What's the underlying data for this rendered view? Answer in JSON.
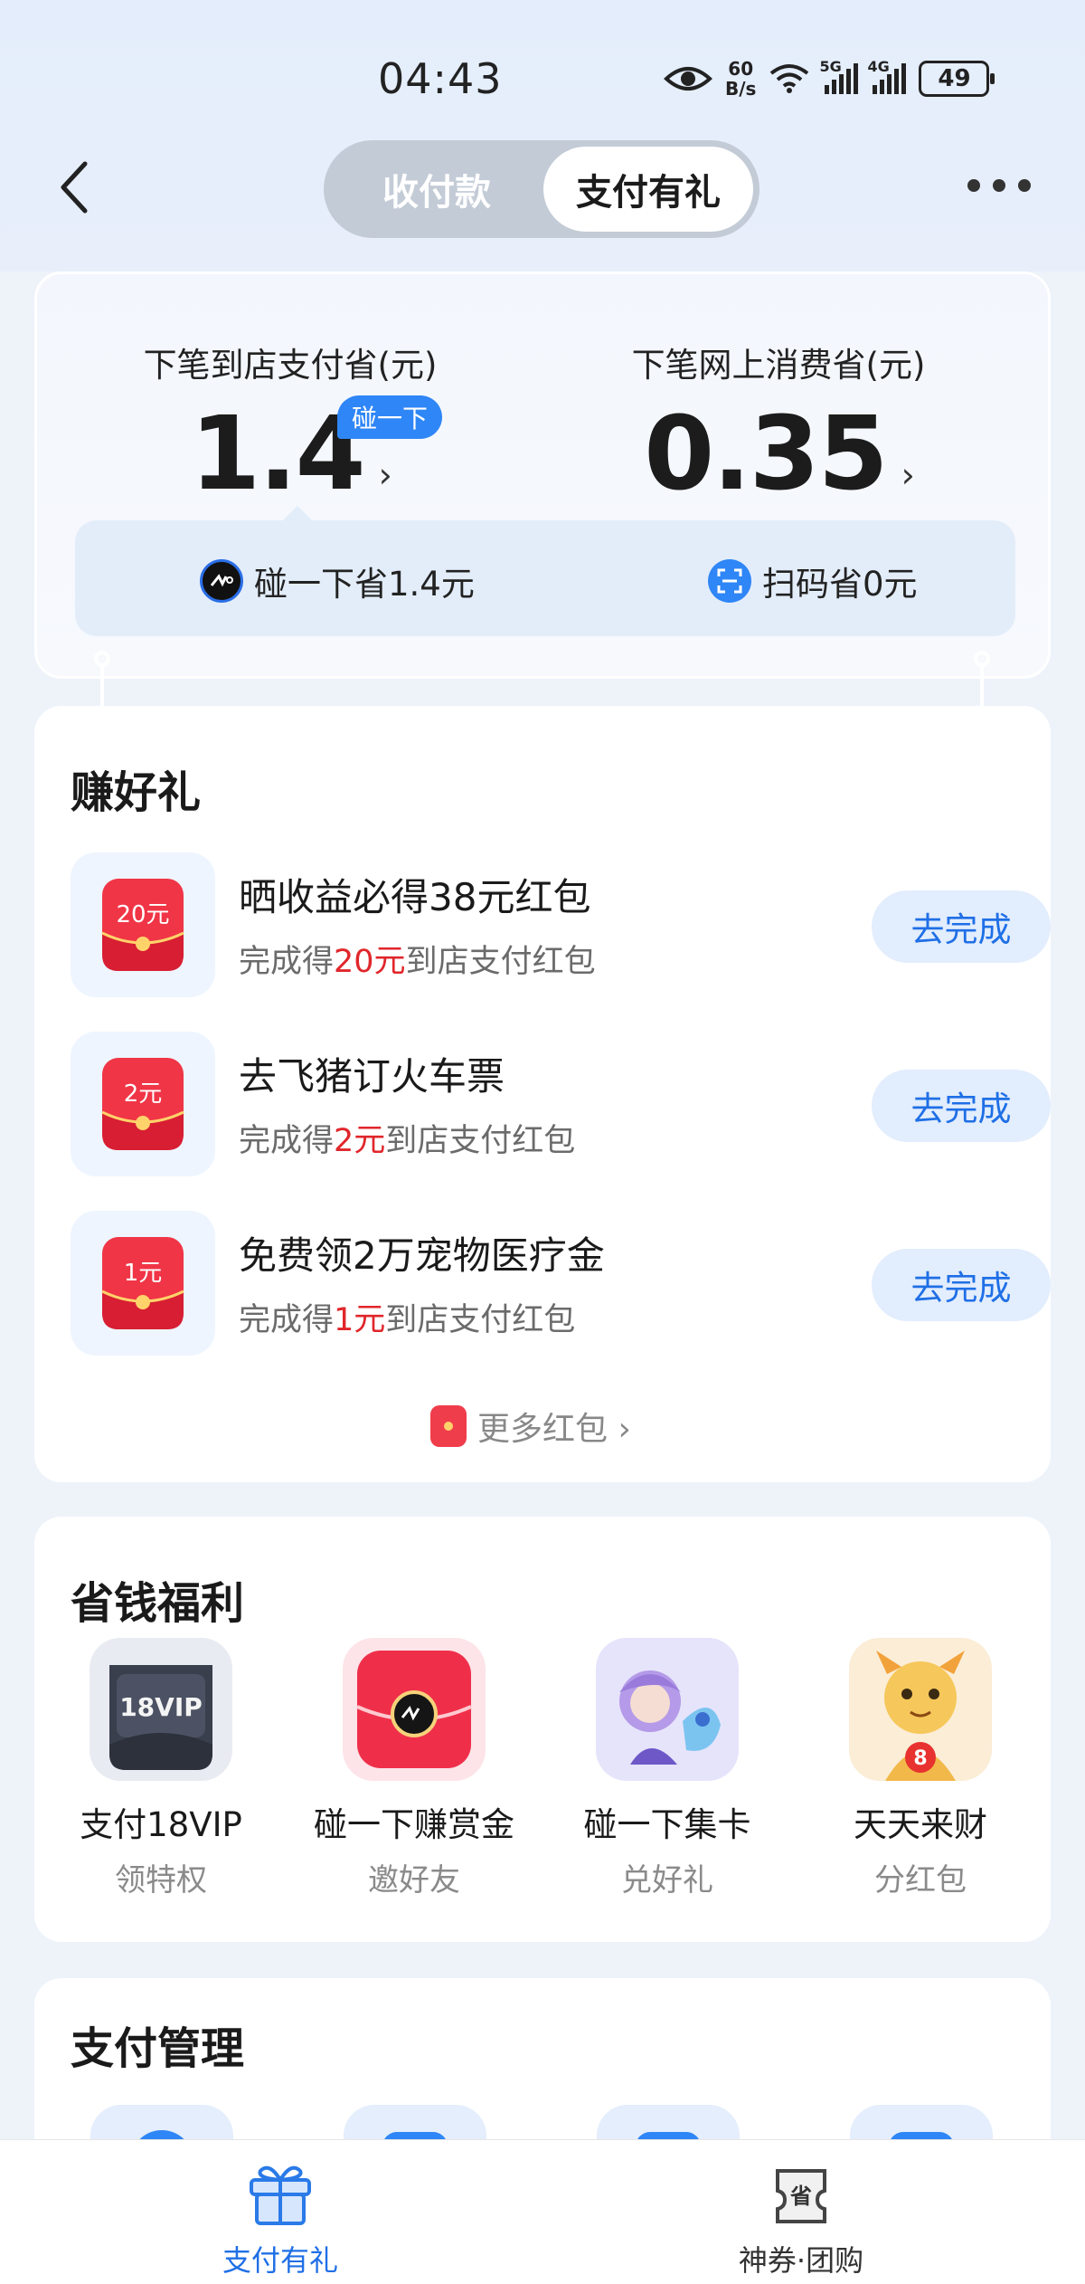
{
  "status_bar": {
    "time": "04:43",
    "net_speed_value": "60",
    "net_speed_unit": "B/s",
    "signal_1": "5G",
    "signal_2": "4G",
    "battery": "49",
    "icons": [
      "eye-icon",
      "wifi-icon",
      "signal-icon",
      "signal-icon",
      "battery-icon"
    ]
  },
  "nav": {
    "tabs": [
      {
        "label": "收付款",
        "active": false
      },
      {
        "label": "支付有礼",
        "active": true
      }
    ],
    "back_icon": "chevron-left-icon",
    "more_icon": "more-horizontal-icon"
  },
  "savings": {
    "left_label": "下笔到店支付省(元)",
    "left_value": "1.4",
    "bump_tag": "碰一下",
    "right_label": "下笔网上消费省(元)",
    "right_value": "0.35",
    "bump_saving": "碰一下省1.4元",
    "scan_saving": "扫码省0元"
  },
  "earn": {
    "title": "赚好礼",
    "tasks": [
      {
        "icon_text": "20元",
        "title": "晒收益必得38元红包",
        "desc_pre": "完成得",
        "amount": "20元",
        "desc_post": "到店支付红包",
        "button": "去完成"
      },
      {
        "icon_text": "2元",
        "title": "去飞猪订火车票",
        "desc_pre": "完成得",
        "amount": "2元",
        "desc_post": "到店支付红包",
        "button": "去完成"
      },
      {
        "icon_text": "1元",
        "title": "免费领2万宠物医疗金",
        "desc_pre": "完成得",
        "amount": "1元",
        "desc_post": "到店支付红包",
        "button": "去完成"
      }
    ],
    "more_link": "更多红包 ›"
  },
  "benefits": {
    "title": "省钱福利",
    "items": [
      {
        "title": "支付18VIP",
        "sub": "领特权",
        "badge": "18VIP"
      },
      {
        "title": "碰一下赚赏金",
        "sub": "邀好友"
      },
      {
        "title": "碰一下集卡",
        "sub": "兑好礼"
      },
      {
        "title": "天天来财",
        "sub": "分红包",
        "badge": "8"
      }
    ]
  },
  "management": {
    "title": "支付管理"
  },
  "bottom_nav": {
    "items": [
      {
        "label": "支付有礼",
        "icon": "gift-icon",
        "active": true
      },
      {
        "label": "神券·团购",
        "icon": "coupon-icon",
        "badge": "省",
        "active": false
      }
    ]
  },
  "colors": {
    "accent": "#1f6fe6",
    "red": "#e0262b",
    "page_bg": "#eef3fa"
  }
}
